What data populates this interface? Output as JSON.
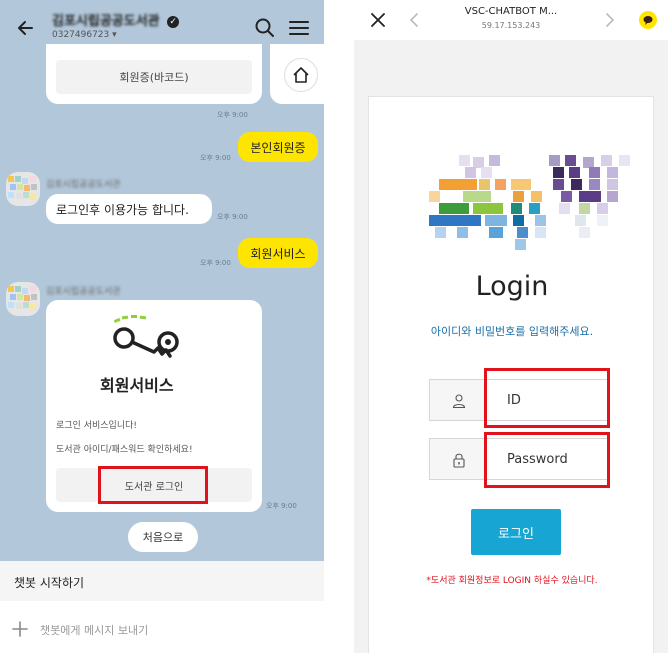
{
  "chat": {
    "title": "김포시립공공도서관",
    "subtitle": "0327496723",
    "messages": {
      "member_card_button": "회원증(바코드)",
      "time": "오후 9:00",
      "user_msg_1": "본인회원증",
      "bot_msg_1": "로그인후 이용가능 합니다.",
      "user_msg_2": "회원서비스"
    },
    "service_card": {
      "title": "회원서비스",
      "line1": "로그인 서비스입니다!",
      "line2": "도서관 아이디/패스워드 확인하세요!",
      "button": "도서관 로그인"
    },
    "quick_reply": "처음으로",
    "footer": {
      "start_label": "챗봇 시작하기",
      "input_placeholder": "챗봇에게 메시지 보내기"
    },
    "icons": [
      "back-arrow-icon",
      "verified-icon",
      "search-icon",
      "menu-icon",
      "home-icon",
      "key-icon",
      "plus-icon"
    ]
  },
  "browser": {
    "title": "VSC-CHATBOT M...",
    "address": "59.17.153.243",
    "login_title": "Login",
    "login_sub": "아이디와 비밀번호를 입력해주세요.",
    "id_placeholder": "ID",
    "password_placeholder": "Password",
    "login_button": "로그인",
    "notice": "*도서관 회원정보로 LOGIN 하실수 있습니다.",
    "icons": [
      "close-icon",
      "back-chevron-icon",
      "forward-chevron-icon",
      "kakao-icon",
      "user-icon",
      "lock-icon"
    ]
  },
  "colors": {
    "chat_bg": "#b2c7da",
    "yellow_bubble": "#fee500",
    "highlight_red": "#e0121c",
    "login_button": "#17a6d4",
    "subtitle_blue": "#1a6ea8"
  }
}
